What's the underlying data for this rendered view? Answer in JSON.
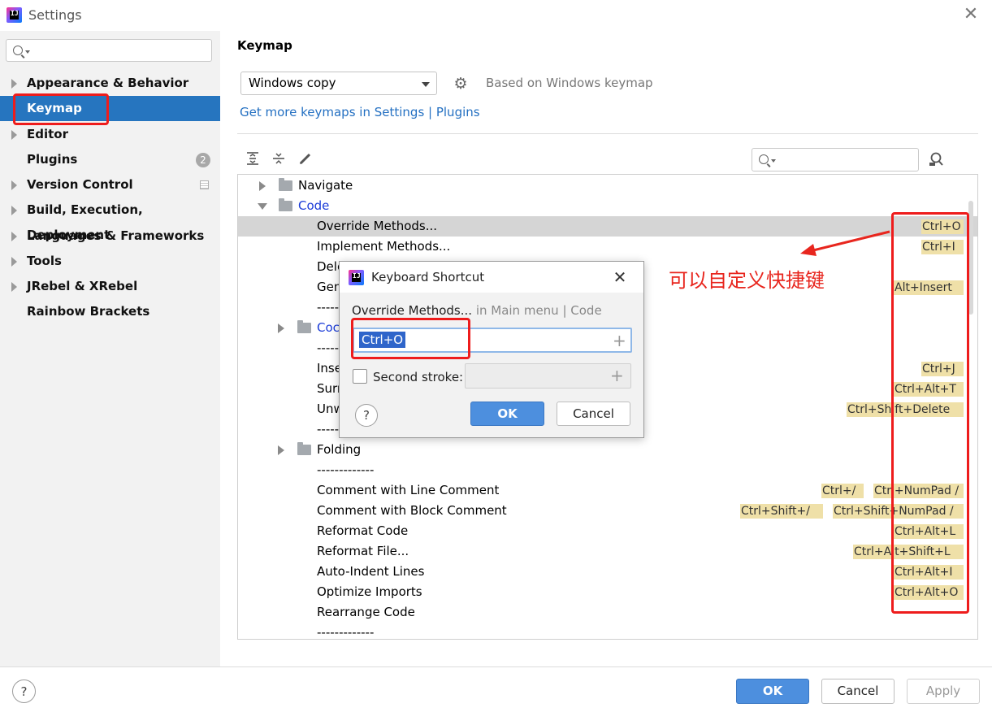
{
  "window": {
    "title": "Settings",
    "app_icon_text": "IJ"
  },
  "sidebar": {
    "search": {
      "placeholder": "",
      "value": ""
    },
    "items": [
      {
        "label": "Appearance & Behavior",
        "expandable": true
      },
      {
        "label": "Keymap",
        "expandable": false,
        "selected": true
      },
      {
        "label": "Editor",
        "expandable": true
      },
      {
        "label": "Plugins",
        "expandable": false,
        "badge": "2"
      },
      {
        "label": "Version Control",
        "expandable": true
      },
      {
        "label": "Build, Execution, Deployment",
        "expandable": true
      },
      {
        "label": "Languages & Frameworks",
        "expandable": true
      },
      {
        "label": "Tools",
        "expandable": true
      },
      {
        "label": "JRebel & XRebel",
        "expandable": true
      },
      {
        "label": "Rainbow Brackets",
        "expandable": false
      }
    ]
  },
  "main": {
    "title": "Keymap",
    "keymap_select": {
      "value": "Windows copy"
    },
    "based_on": "Based on Windows keymap",
    "more_link": "Get more keymaps in Settings | Plugins",
    "toolbar_icons": [
      "expand-all-icon",
      "collapse-all-icon",
      "edit-icon"
    ],
    "tree_search": {
      "placeholder": "",
      "value": ""
    }
  },
  "tree": {
    "rows": [
      {
        "text": "Navigate",
        "kind": "folder",
        "expanded": false,
        "shortcuts": []
      },
      {
        "text": "Code",
        "kind": "folder",
        "expanded": true,
        "shortcuts": []
      },
      {
        "text": "Override Methods...",
        "kind": "action",
        "selected": true,
        "shortcuts": [
          "Ctrl+O"
        ]
      },
      {
        "text": "Implement Methods...",
        "kind": "action",
        "shortcuts": [
          "Ctrl+I"
        ]
      },
      {
        "text": "Dele",
        "kind": "action",
        "shortcuts": []
      },
      {
        "text": "Gen",
        "kind": "action",
        "shortcuts": [
          "Alt+Insert"
        ]
      },
      {
        "text": "-----",
        "kind": "separator",
        "shortcuts": []
      },
      {
        "text": "Coc",
        "kind": "subfolder",
        "expanded": false,
        "shortcuts": []
      },
      {
        "text": "-----",
        "kind": "separator",
        "shortcuts": []
      },
      {
        "text": "Inse",
        "kind": "action",
        "shortcuts": [
          "Ctrl+J"
        ]
      },
      {
        "text": "Surr",
        "kind": "action",
        "shortcuts": [
          "Ctrl+Alt+T"
        ]
      },
      {
        "text": "Unw",
        "kind": "action",
        "shortcuts": [
          "Ctrl+Shift+Delete"
        ]
      },
      {
        "text": "-----",
        "kind": "separator",
        "shortcuts": []
      },
      {
        "text": "Folding",
        "kind": "subfolder",
        "expanded": false,
        "shortcuts": []
      },
      {
        "text": "-------------",
        "kind": "separator",
        "shortcuts": []
      },
      {
        "text": "Comment with Line Comment",
        "kind": "action",
        "shortcuts": [
          "Ctrl+/",
          "Ctrl+NumPad /"
        ]
      },
      {
        "text": "Comment with Block Comment",
        "kind": "action",
        "shortcuts": [
          "Ctrl+Shift+/",
          "Ctrl+Shift+NumPad /"
        ]
      },
      {
        "text": "Reformat Code",
        "kind": "action",
        "shortcuts": [
          "Ctrl+Alt+L"
        ]
      },
      {
        "text": "Reformat File...",
        "kind": "action",
        "shortcuts": [
          "Ctrl+Alt+Shift+L"
        ]
      },
      {
        "text": "Auto-Indent Lines",
        "kind": "action",
        "shortcuts": [
          "Ctrl+Alt+I"
        ]
      },
      {
        "text": "Optimize Imports",
        "kind": "action",
        "shortcuts": [
          "Ctrl+Alt+O"
        ]
      },
      {
        "text": "Rearrange Code",
        "kind": "action",
        "shortcuts": []
      },
      {
        "text": "-------------",
        "kind": "separator",
        "shortcuts": []
      }
    ]
  },
  "annotation": {
    "text": "可以自定义快捷键",
    "color": "#e8261e"
  },
  "dialog": {
    "title": "Keyboard Shortcut",
    "action": "Override Methods...",
    "context": " in Main menu | Code",
    "first_stroke": {
      "value": "Ctrl+O"
    },
    "second_stroke_label": "Second stroke:",
    "second_stroke_checked": false,
    "second_stroke_value": "",
    "help": "?",
    "ok": "OK",
    "cancel": "Cancel"
  },
  "footer": {
    "help": "?",
    "ok": "OK",
    "cancel": "Cancel",
    "apply": "Apply"
  },
  "colors": {
    "accent": "#2675bf",
    "shortcut_highlight": "#efe0a8",
    "annotation_red": "#ee1c1c",
    "link": "#2470c2"
  }
}
